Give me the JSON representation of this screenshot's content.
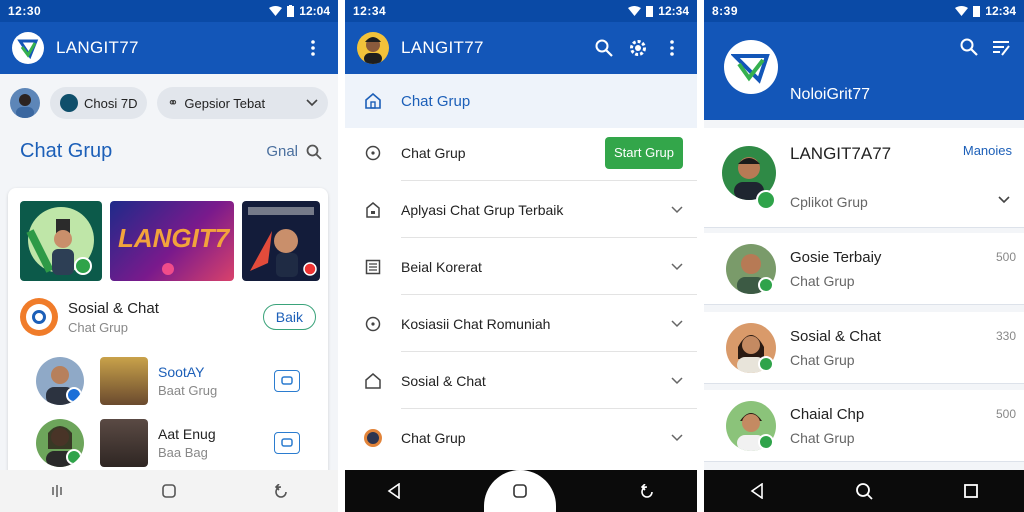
{
  "screen1": {
    "status_time": "12:30",
    "status_right": "12:04",
    "app_title": "LANGIT77",
    "chip_1": "Chosi 7D",
    "chip_2": "Gepsior Tebat",
    "section_title": "Chat Grup",
    "section_action": "Gnal",
    "thumb_label": "LANGIT7",
    "item_main_title": "Sosial & Chat",
    "item_main_sub": "Chat Grup",
    "item_main_button": "Baik",
    "rows": [
      {
        "title": "SootAY",
        "sub": "Baat Grug"
      },
      {
        "title": "Aat Enug",
        "sub": "Baa Bag"
      }
    ]
  },
  "screen2": {
    "status_time": "12:34",
    "status_right": "12:34",
    "app_title": "LANGIT77",
    "header_item": "Chat Grup",
    "green_button": "Start Grup",
    "items": [
      {
        "label": "Chat Grup"
      },
      {
        "label": "Aplyasi Chat Grup Terbaik"
      },
      {
        "label": "Beial Korerat"
      },
      {
        "label": "Kosiasii Chat Romuniah"
      },
      {
        "label": "Sosial & Chat"
      },
      {
        "label": "Chat Grup"
      }
    ]
  },
  "screen3": {
    "status_time": "8:39",
    "status_right": "12:34",
    "hero_title": "NoloiGrit77",
    "top_card_title": "LANGIT7A77",
    "top_card_action": "Manoies",
    "top_card_sub": "Cplikot Grup",
    "chats": [
      {
        "title": "Gosie Terbaiy",
        "sub": "Chat Grup",
        "meta": "500"
      },
      {
        "title": "Sosial & Chat",
        "sub": "Chat Grup",
        "meta": "330"
      },
      {
        "title": "Chaial Chp",
        "sub": "Chat Grup",
        "meta": "500"
      }
    ]
  },
  "colors": {
    "primary": "#1356b8",
    "status": "#0a4aa6",
    "accent_green": "#33a64a",
    "text_blue": "#1c5fb8"
  }
}
